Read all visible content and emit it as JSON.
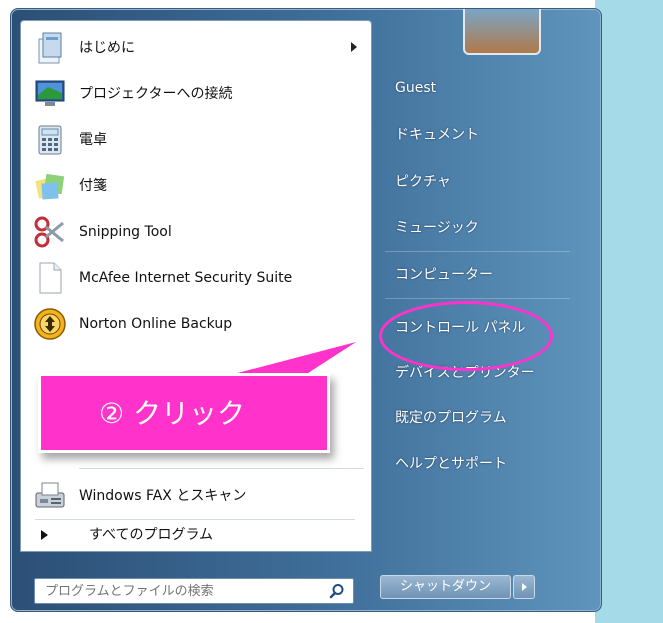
{
  "left_items": [
    {
      "label": "はじめに",
      "icon": "getting-started-icon",
      "has_submenu": true
    },
    {
      "label": "プロジェクターへの接続",
      "icon": "projector-icon",
      "has_submenu": false
    },
    {
      "label": "電卓",
      "icon": "calculator-icon",
      "has_submenu": false
    },
    {
      "label": "付箋",
      "icon": "sticky-notes-icon",
      "has_submenu": false
    },
    {
      "label": "Snipping Tool",
      "icon": "scissors-icon",
      "has_submenu": false
    },
    {
      "label": "McAfee Internet Security Suite",
      "icon": "document-icon",
      "has_submenu": false
    },
    {
      "label": "Norton Online Backup",
      "icon": "norton-icon",
      "has_submenu": false
    },
    {
      "label": "Windows FAX とスキャン",
      "icon": "fax-icon",
      "has_submenu": false
    }
  ],
  "all_programs": "すべてのプログラム",
  "search": {
    "placeholder": "プログラムとファイルの検索"
  },
  "right_items": [
    {
      "label": "Guest"
    },
    {
      "label": "ドキュメント"
    },
    {
      "label": "ピクチャ"
    },
    {
      "label": "ミュージック"
    },
    {
      "label": "コンピューター"
    },
    {
      "label": "コントロール パネル"
    },
    {
      "label": "デバイスとプリンター"
    },
    {
      "label": "既定のプログラム"
    },
    {
      "label": "ヘルプとサポート"
    }
  ],
  "shutdown": {
    "label": "シャットダウン"
  },
  "callout": {
    "text": "② クリック"
  },
  "colors": {
    "highlight": "#ff33cc",
    "menu_dark": "#2c4f76",
    "desktop": "#a5dbe9"
  }
}
